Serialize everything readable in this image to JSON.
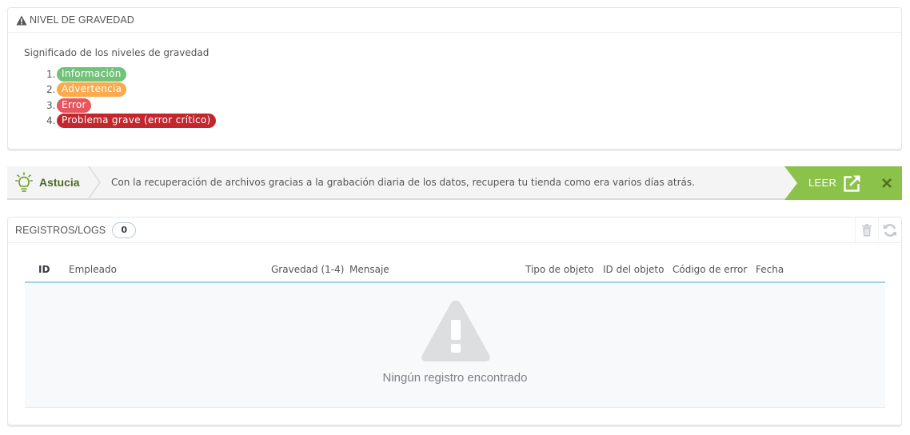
{
  "severity_panel": {
    "title": "NIVEL DE GRAVEDAD",
    "intro": "Significado de los niveles de gravedad",
    "levels": [
      {
        "num": "1.",
        "label": "Información",
        "color": "#72c279"
      },
      {
        "num": "2.",
        "label": "Advertencia",
        "color": "#fbaa4c"
      },
      {
        "num": "3.",
        "label": "Error",
        "color": "#e5565f"
      },
      {
        "num": "4.",
        "label": "Problema grave (error crítico)",
        "color": "#c1272d"
      }
    ]
  },
  "tip": {
    "title": "Astucia",
    "message": "Con la recuperación de archivos gracias a la grabación diaria de los datos, recupera tu tienda como era varios días atrás.",
    "read_label": "LEER",
    "accent_color": "#8bc34a"
  },
  "logs_panel": {
    "title": "REGISTROS/LOGS",
    "count": "0",
    "columns": [
      "ID",
      "Empleado",
      "Gravedad (1-4)",
      "Mensaje",
      "Tipo de objeto",
      "ID del objeto",
      "Código de error",
      "Fecha"
    ],
    "empty_message": "Ningún registro encontrado",
    "actions": [
      "trash-icon",
      "refresh-icon"
    ]
  }
}
